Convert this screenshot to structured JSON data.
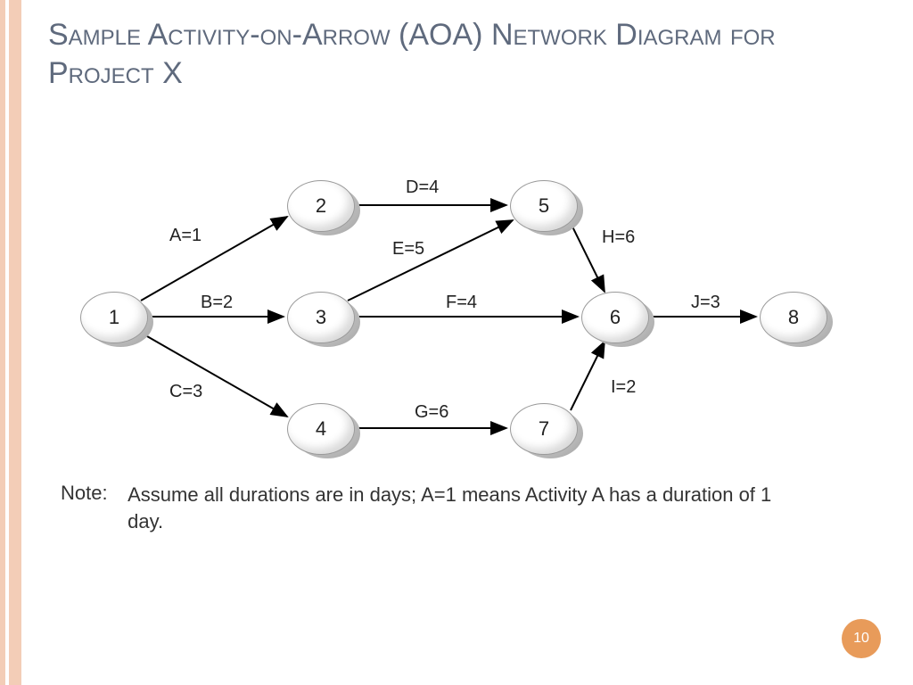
{
  "title": "Sample Activity-on-Arrow (AOA) Network Diagram for Project X",
  "note_label": "Note:",
  "note_text": "Assume all durations are in days;  A=1 means Activity A has a duration of 1 day.",
  "page_number": "10",
  "nodes": {
    "n1": "1",
    "n2": "2",
    "n3": "3",
    "n4": "4",
    "n5": "5",
    "n6": "6",
    "n7": "7",
    "n8": "8"
  },
  "edges": {
    "A": "A=1",
    "B": "B=2",
    "C": "C=3",
    "D": "D=4",
    "E": "E=5",
    "F": "F=4",
    "G": "G=6",
    "H": "H=6",
    "I": "I=2",
    "J": "J=3"
  },
  "chart_data": {
    "type": "network",
    "nodes": [
      1,
      2,
      3,
      4,
      5,
      6,
      7,
      8
    ],
    "activities": [
      {
        "name": "A",
        "from": 1,
        "to": 2,
        "duration": 1
      },
      {
        "name": "B",
        "from": 1,
        "to": 3,
        "duration": 2
      },
      {
        "name": "C",
        "from": 1,
        "to": 4,
        "duration": 3
      },
      {
        "name": "D",
        "from": 2,
        "to": 5,
        "duration": 4
      },
      {
        "name": "E",
        "from": 3,
        "to": 5,
        "duration": 5
      },
      {
        "name": "F",
        "from": 3,
        "to": 6,
        "duration": 4
      },
      {
        "name": "G",
        "from": 4,
        "to": 7,
        "duration": 6
      },
      {
        "name": "H",
        "from": 5,
        "to": 6,
        "duration": 6
      },
      {
        "name": "I",
        "from": 7,
        "to": 6,
        "duration": 2
      },
      {
        "name": "J",
        "from": 6,
        "to": 8,
        "duration": 3
      }
    ]
  }
}
